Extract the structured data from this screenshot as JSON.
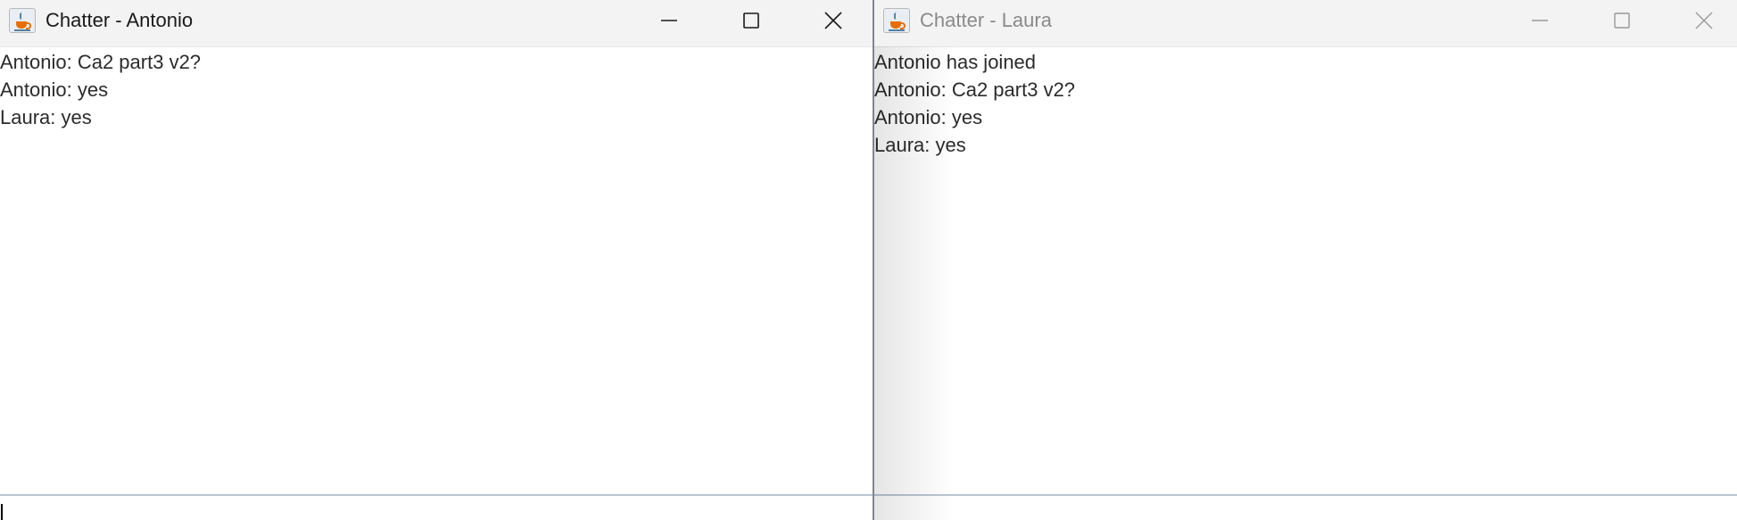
{
  "windows": [
    {
      "title": "Chatter - Antonio",
      "state": "active",
      "messages": [
        "Antonio: Ca2 part3 v2?",
        "Antonio: yes",
        "Laura: yes"
      ],
      "input_value": ""
    },
    {
      "title": "Chatter - Laura",
      "state": "inactive",
      "messages": [
        "Antonio has joined",
        "Antonio: Ca2 part3 v2?",
        "Antonio: yes",
        "Laura: yes"
      ],
      "input_value": ""
    }
  ]
}
